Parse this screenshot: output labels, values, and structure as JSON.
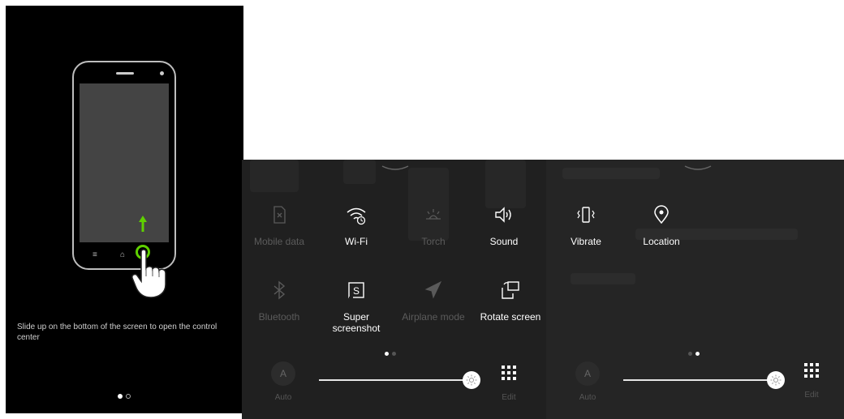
{
  "tutorial": {
    "instruction": "Slide up on the bottom of the screen to open the control center",
    "page_dots": [
      "active",
      "inactive"
    ],
    "swipe_color": "#5fd000"
  },
  "control_center_1": {
    "tiles": [
      {
        "label": "Mobile data",
        "icon": "mobile-data-icon",
        "state": "off"
      },
      {
        "label": "Wi-Fi",
        "icon": "wifi-icon",
        "state": "on"
      },
      {
        "label": "Torch",
        "icon": "torch-icon",
        "state": "off"
      },
      {
        "label": "Sound",
        "icon": "sound-icon",
        "state": "on"
      },
      {
        "label": "Bluetooth",
        "icon": "bluetooth-icon",
        "state": "off"
      },
      {
        "label": "Super screenshot",
        "icon": "screenshot-icon",
        "state": "on"
      },
      {
        "label": "Airplane mode",
        "icon": "airplane-icon",
        "state": "off"
      },
      {
        "label": "Rotate screen",
        "icon": "rotate-icon",
        "state": "on"
      }
    ],
    "page_dots": [
      "active",
      "inactive"
    ],
    "brightness": {
      "auto_glyph": "A",
      "auto_label": "Auto",
      "level": 1.0,
      "edit_label": "Edit"
    }
  },
  "control_center_2": {
    "tiles": [
      {
        "label": "Vibrate",
        "icon": "vibrate-icon",
        "state": "on"
      },
      {
        "label": "Location",
        "icon": "location-icon",
        "state": "on"
      }
    ],
    "page_dots": [
      "inactive",
      "active"
    ],
    "brightness": {
      "auto_glyph": "A",
      "auto_label": "Auto",
      "level": 1.0,
      "edit_label": "Edit"
    }
  }
}
